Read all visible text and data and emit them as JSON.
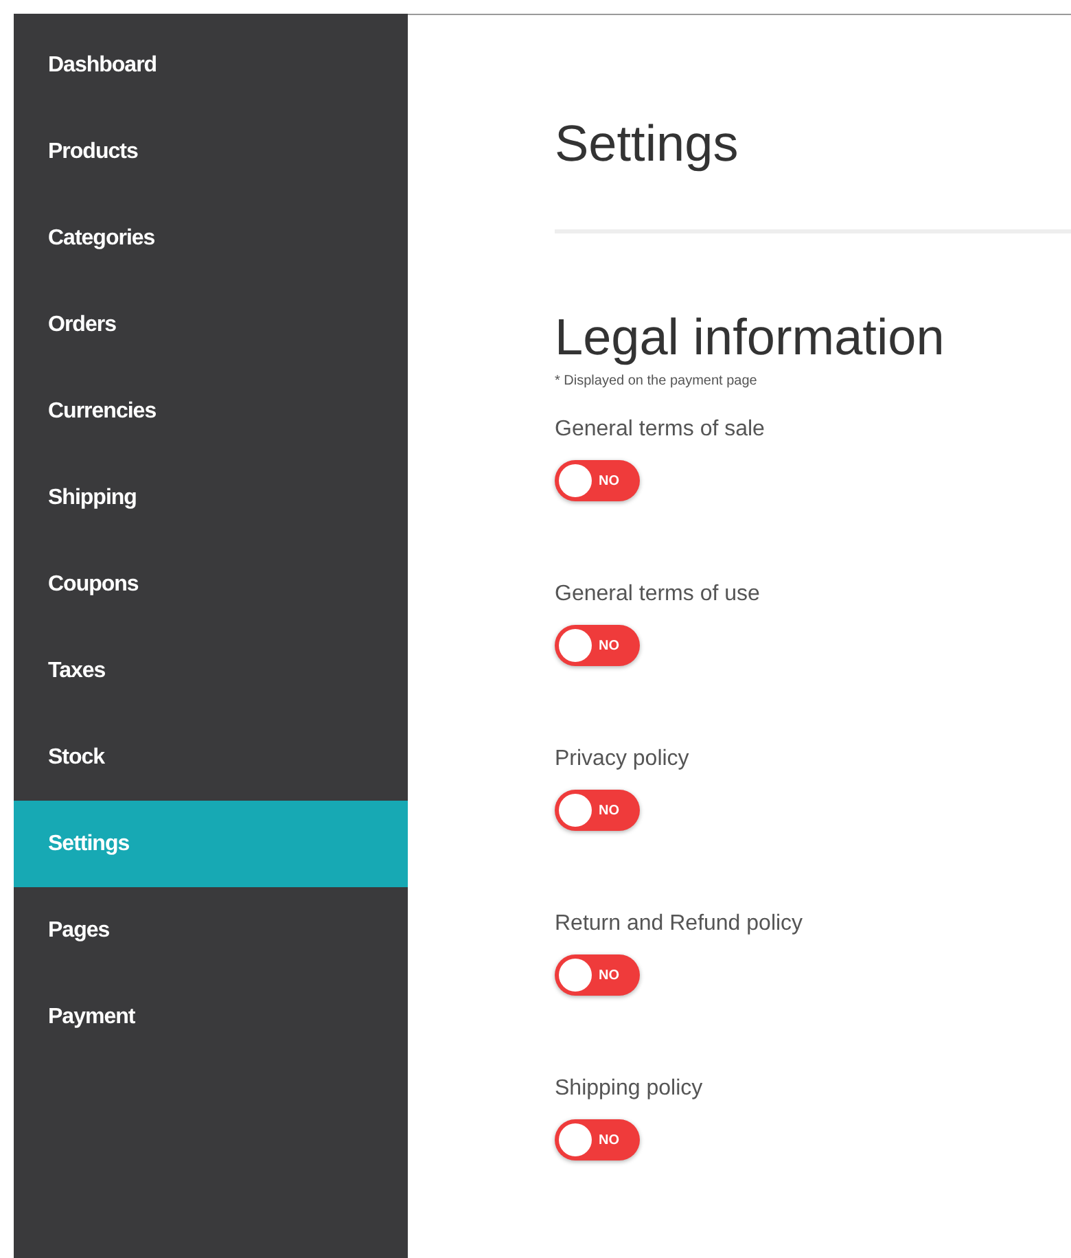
{
  "sidebar": {
    "items": [
      {
        "label": "Dashboard",
        "selected": false
      },
      {
        "label": "Products",
        "selected": false
      },
      {
        "label": "Categories",
        "selected": false
      },
      {
        "label": "Orders",
        "selected": false
      },
      {
        "label": "Currencies",
        "selected": false
      },
      {
        "label": "Shipping",
        "selected": false
      },
      {
        "label": "Coupons",
        "selected": false
      },
      {
        "label": "Taxes",
        "selected": false
      },
      {
        "label": "Stock",
        "selected": false
      },
      {
        "label": "Settings",
        "selected": true
      },
      {
        "label": "Pages",
        "selected": false
      },
      {
        "label": "Payment",
        "selected": false
      }
    ]
  },
  "page_title": "Settings",
  "section": {
    "title": "Legal information",
    "note": "* Displayed on the payment page",
    "toggles": [
      {
        "label": "General terms of sale",
        "on": false,
        "state_text": "NO"
      },
      {
        "label": "General terms of use",
        "on": false,
        "state_text": "NO"
      },
      {
        "label": "Privacy policy",
        "on": false,
        "state_text": "NO"
      },
      {
        "label": "Return and Refund policy",
        "on": false,
        "state_text": "NO"
      },
      {
        "label": "Shipping policy",
        "on": false,
        "state_text": "NO"
      }
    ]
  }
}
